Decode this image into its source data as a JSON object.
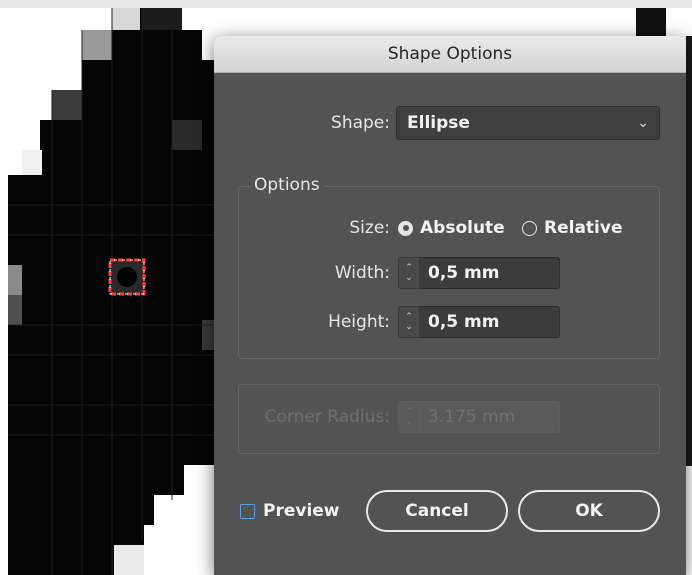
{
  "dialog": {
    "title": "Shape Options",
    "shape": {
      "label": "Shape:",
      "value": "Ellipse"
    },
    "options_group": {
      "title": "Options",
      "size": {
        "label": "Size:",
        "absolute_label": "Absolute",
        "relative_label": "Relative",
        "selected": "Absolute"
      },
      "width": {
        "label": "Width:",
        "value": "0,5 mm"
      },
      "height": {
        "label": "Height:",
        "value": "0,5 mm"
      }
    },
    "corner_radius": {
      "label": "Corner Radius:",
      "value": "3.175 mm",
      "disabled": true
    },
    "preview_label": "Preview",
    "preview_checked": false,
    "cancel_label": "Cancel",
    "ok_label": "OK"
  },
  "colors": {
    "dialog_bg": "#535353",
    "accent_blue": "#5aa0ea",
    "selection_red": "#ff3b3b"
  },
  "icons": [
    "chevron-down-icon",
    "stepper-icon",
    "radio-icon",
    "checkbox-icon"
  ]
}
